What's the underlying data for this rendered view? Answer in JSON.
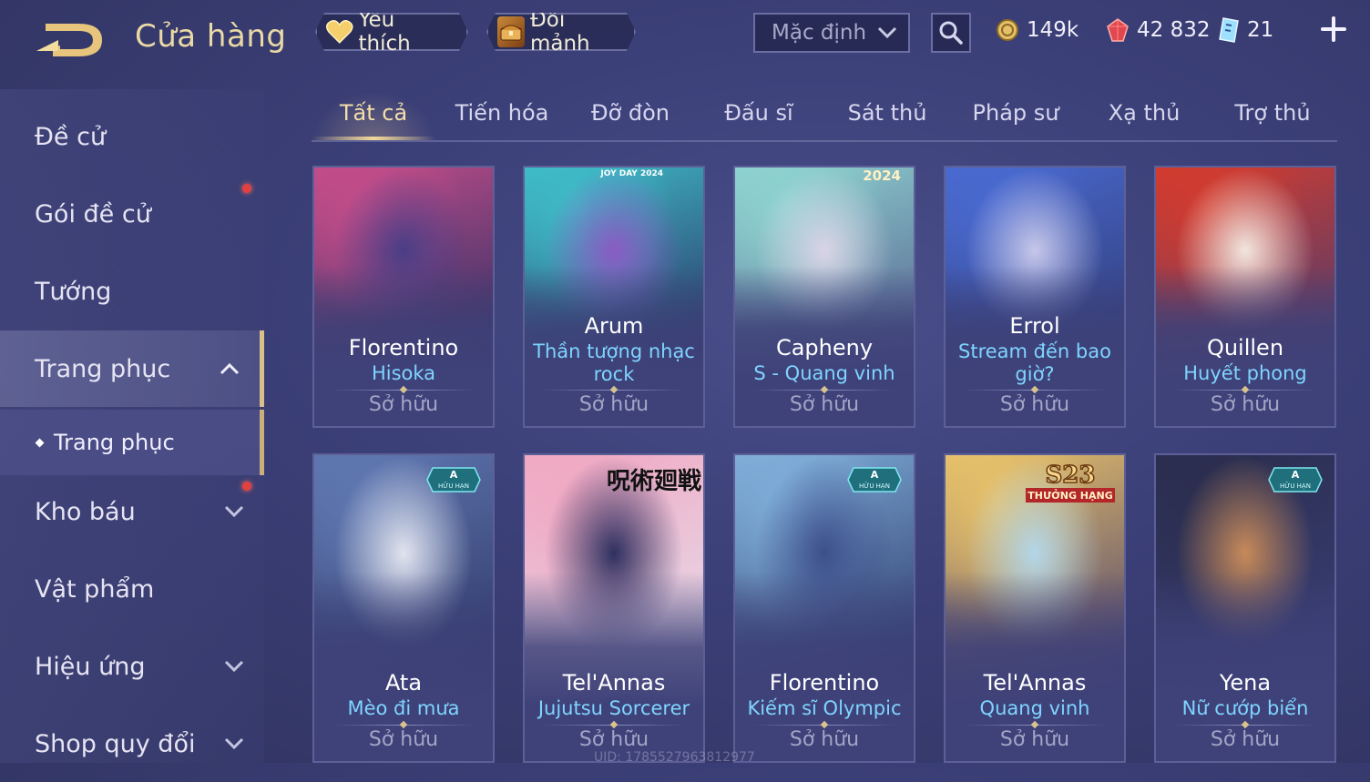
{
  "header": {
    "title": "Cửa hàng",
    "favorites_label": "Yêu thích",
    "exchange_label": "Đổi mảnh",
    "sort_value": "Mặc định",
    "currencies": [
      {
        "icon": "gold-coin-icon",
        "value": "149k"
      },
      {
        "icon": "ruby-icon",
        "value": "42 832"
      },
      {
        "icon": "voucher-icon",
        "value": "21"
      }
    ]
  },
  "sidebar": {
    "items": [
      {
        "label": "Đề cử"
      },
      {
        "label": "Gói đề cử"
      },
      {
        "label": "Tướng"
      },
      {
        "label": "Trang phục"
      },
      {
        "label": "Kho báu"
      },
      {
        "label": "Vật phẩm"
      },
      {
        "label": "Hiệu ứng"
      },
      {
        "label": "Shop quy đổi"
      }
    ],
    "sub_item": "Trang phục"
  },
  "tabs": [
    "Tất cả",
    "Tiến hóa",
    "Đỡ đòn",
    "Đấu sĩ",
    "Sát thủ",
    "Pháp sư",
    "Xạ thủ",
    "Trợ thủ"
  ],
  "cards": [
    {
      "hero": "Florentino",
      "skin": "Hisoka",
      "status": "Sở hữu",
      "colors": [
        "#c34d8a",
        "#4a3e86",
        "#2a2f62"
      ]
    },
    {
      "hero": "Arum",
      "skin": "Thần tượng nhạc rock",
      "status": "Sở hữu",
      "badge_text": "JOY DAY 2024",
      "colors": [
        "#3fbcc8",
        "#8a5cc4",
        "#2a2f62"
      ]
    },
    {
      "hero": "Capheny",
      "skin": "S - Quang vinh",
      "status": "Sở hữu",
      "badge_text": "2024",
      "colors": [
        "#8ed3d0",
        "#d9d4e6",
        "#56608f"
      ]
    },
    {
      "hero": "Errol",
      "skin": "Stream đến bao giờ?",
      "status": "Sở hữu",
      "colors": [
        "#4a6ad0",
        "#c6c7e9",
        "#2f3a74"
      ]
    },
    {
      "hero": "Quillen",
      "skin": "Huyết phong",
      "status": "Sở hữu",
      "colors": [
        "#d23b2f",
        "#f2e6df",
        "#4a3d70"
      ]
    },
    {
      "hero": "Ata",
      "skin": "Mèo đi mưa",
      "status": "Sở hữu",
      "badge_text": "A",
      "badge_sub": "HỮU HẠN",
      "colors": [
        "#5f77b0",
        "#e1e4ef",
        "#2c3464"
      ]
    },
    {
      "hero": "Tel'Annas",
      "skin": "Jujutsu Sorcerer",
      "status": "Sở hữu",
      "badge_text": "呪術廻戦",
      "colors": [
        "#f0a9c3",
        "#2f3060",
        "#e5e1ee"
      ]
    },
    {
      "hero": "Florentino",
      "skin": "Kiếm sĩ Olympic",
      "status": "Sở hữu",
      "badge_text": "A",
      "badge_sub": "HỮU HẠN",
      "colors": [
        "#7faed9",
        "#3d4f8a",
        "#273062"
      ]
    },
    {
      "hero": "Tel'Annas",
      "skin": "Quang vinh",
      "status": "Sở hữu",
      "badge_text": "S23",
      "badge_sub": "THƯỞNG HẠNG",
      "colors": [
        "#e7c16a",
        "#b3d6e8",
        "#463c6d"
      ]
    },
    {
      "hero": "Yena",
      "skin": "Nữ cướp biển",
      "status": "Sở hữu",
      "badge_text": "A",
      "badge_sub": "HỮU HẠN",
      "colors": [
        "#2b2e4f",
        "#c78a5a",
        "#3a3f78"
      ]
    }
  ],
  "footer": {
    "uid": "UID: 1785527963812977"
  }
}
